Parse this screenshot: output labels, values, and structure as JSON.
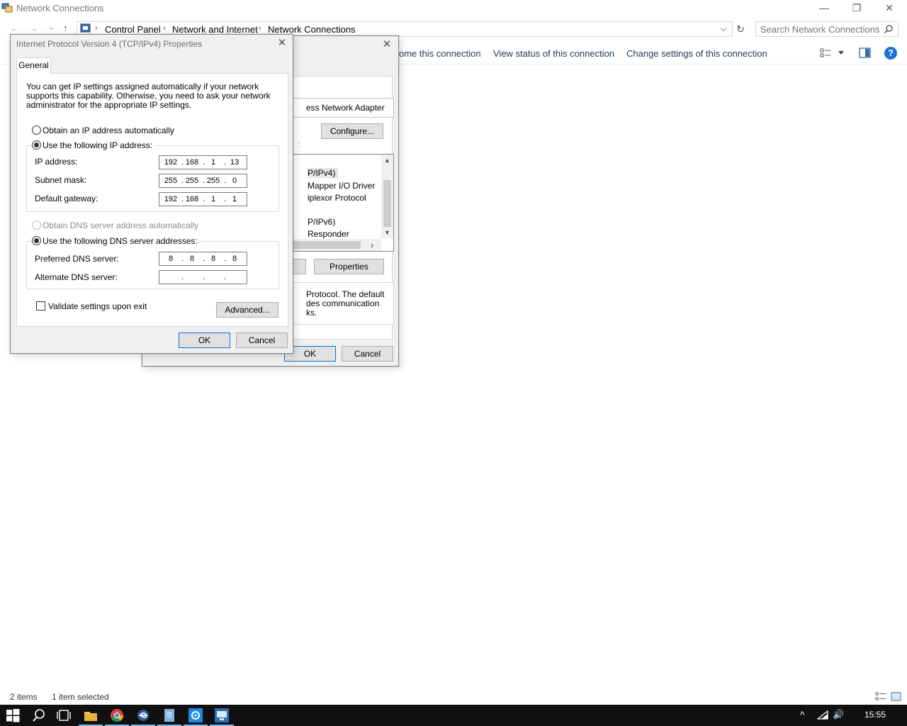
{
  "window": {
    "title": "Network Connections",
    "minimize": "—",
    "maximize": "❐",
    "close": "✕"
  },
  "address": {
    "crumbs": [
      "Control Panel",
      "Network and Internet",
      "Network Connections"
    ],
    "separator": "›",
    "dropdown": "⌵",
    "refresh": "↻",
    "search_placeholder": "Search Network Connections",
    "nav": {
      "back": "←",
      "forward": "→",
      "recent": "⌄",
      "up": "↑"
    }
  },
  "commandbar": {
    "items": [
      "ome this connection",
      "View status of this connection",
      "Change settings of this connection"
    ],
    "help": "?"
  },
  "status": {
    "items_count": "2 items",
    "selected": "1 item selected"
  },
  "taskbar": {
    "clock": "15:55",
    "tray_expand": "^",
    "volume": "🔊"
  },
  "bg_dialog": {
    "close": "✕",
    "adapter_partial": "ess Network Adapter",
    "configure_label": "Configure...",
    "list_items": [
      "P/IPv4)",
      "Mapper I/O Driver",
      "iplexor Protocol",
      "",
      "P/IPv6)",
      "Responder"
    ],
    "scroll_up": "▲",
    "scroll_down": "▼",
    "scroll_right": "›",
    "properties_label": "Properties",
    "desc_lines": [
      "Protocol. The default",
      "des communication",
      "ks."
    ],
    "ok_label": "OK",
    "cancel_label": "Cancel",
    "hint_char": ":"
  },
  "ipv4_dialog": {
    "title": "Internet Protocol Version 4 (TCP/IPv4) Properties",
    "close": "✕",
    "tab_general": "General",
    "intro_text": "You can get IP settings assigned automatically if your network supports this capability. Otherwise, you need to ask your network administrator for the appropriate IP settings.",
    "radio_auto_ip": "Obtain an IP address automatically",
    "radio_manual_ip": "Use the following IP address:",
    "ip_label": "IP address:",
    "ip_value": [
      "192",
      "168",
      "1",
      "13"
    ],
    "subnet_label": "Subnet mask:",
    "subnet_value": [
      "255",
      "255",
      "255",
      "0"
    ],
    "gateway_label": "Default gateway:",
    "gateway_value": [
      "192",
      "168",
      "1",
      "1"
    ],
    "radio_auto_dns": "Obtain DNS server address automatically",
    "radio_manual_dns": "Use the following DNS server addresses:",
    "pref_dns_label": "Preferred DNS server:",
    "pref_dns_value": [
      "8",
      "8",
      "8",
      "8"
    ],
    "alt_dns_label": "Alternate DNS server:",
    "alt_dns_value": [
      "",
      "",
      "",
      ""
    ],
    "validate_label": "Validate settings upon exit",
    "advanced_label": "Advanced...",
    "ok_label": "OK",
    "cancel_label": "Cancel"
  },
  "colors": {
    "accent": "#0078d7",
    "taskbar": "#101010",
    "link_text": "#1e395b"
  }
}
